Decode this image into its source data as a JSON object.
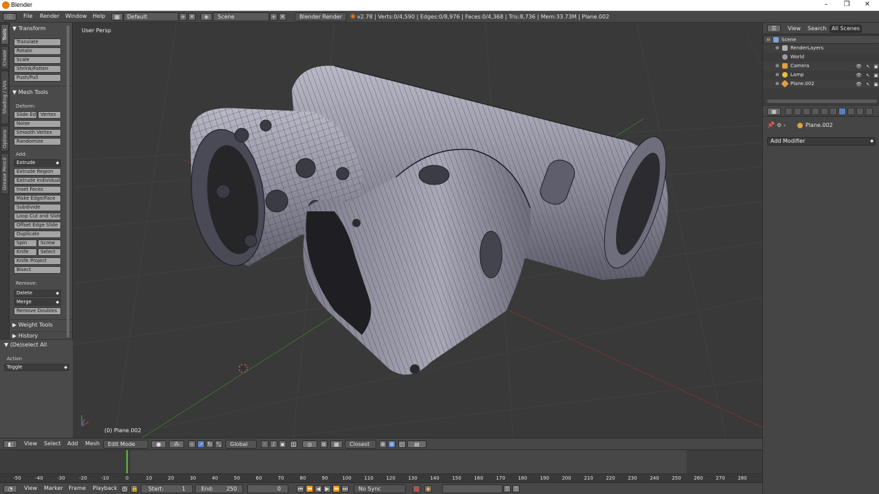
{
  "window": {
    "title": "Blender",
    "controls": [
      "–",
      "❐",
      "✕"
    ]
  },
  "info_header": {
    "menus": [
      "File",
      "Render",
      "Window",
      "Help"
    ],
    "layout": "Default",
    "scene": "Scene",
    "engine": "Blender Render",
    "stats": "v2.78 | Verts:0/4,590 | Edges:0/8,976 | Faces:0/4,368 | Tris:8,736 | Mem:33.73M | Plane.002"
  },
  "tool_tabs": [
    "Tools",
    "Create",
    "Shading / UVs",
    "Options",
    "Grease Pencil"
  ],
  "tool_shelf": {
    "transform": {
      "header": "▼ Transform",
      "buttons": [
        "Translate",
        "Rotate",
        "Scale",
        "Shrink/Fatten",
        "Push/Pull"
      ]
    },
    "mesh_tools": {
      "header": "▼ Mesh Tools",
      "deform_label": "Deform:",
      "slide_edge": "Slide Ed",
      "vertex": "Vertex",
      "noise": "Noise",
      "smooth_vertex": "Smooth Vertex",
      "randomize": "Randomize",
      "add_label": "Add:",
      "extrude": "Extrude",
      "extrude_region": "Extrude Region",
      "extrude_individual": "Extrude Individual",
      "inset_faces": "Inset Faces",
      "make_edge_face": "Make Edge/Face",
      "subdivide": "Subdivide",
      "loop_cut": "Loop Cut and Slide",
      "offset_edge": "Offset Edge Slide",
      "duplicate": "Duplicate",
      "spin": "Spin",
      "screw": "Screw",
      "knife": "Knife",
      "select": "Select",
      "knife_project": "Knife Project",
      "bisect": "Bisect",
      "remove_label": "Remove:",
      "delete": "Delete",
      "merge": "Merge",
      "remove_doubles": "Remove Doubles"
    },
    "weight_tools": "▶ Weight Tools",
    "history": "▶ History",
    "operator": {
      "header": "▼ (De)select All",
      "action_label": "Action",
      "action_value": "Toggle"
    }
  },
  "viewport": {
    "label": "User Persp",
    "object": "(0) Plane.002"
  },
  "viewport_header": {
    "menus": [
      "View",
      "Select",
      "Add",
      "Mesh"
    ],
    "mode": "Edit Mode",
    "orientation": "Global",
    "snap": "Closest"
  },
  "timeline": {
    "current_frame": 0,
    "ticks": [
      -50,
      -40,
      -30,
      -20,
      -10,
      0,
      10,
      20,
      30,
      40,
      50,
      60,
      70,
      80,
      90,
      100,
      110,
      120,
      130,
      140,
      150,
      160,
      170,
      180,
      190,
      200,
      210,
      220,
      230,
      240,
      250,
      260,
      270,
      280
    ],
    "menus": [
      "View",
      "Marker",
      "Frame",
      "Playback"
    ],
    "start_label": "Start:",
    "start_value": "1",
    "end_label": "End:",
    "end_value": "250",
    "frame_value": "0",
    "sync": "No Sync"
  },
  "outliner": {
    "tabs": [
      "View",
      "Search",
      "All Scenes"
    ],
    "items": [
      {
        "name": "Scene",
        "color": "#7aa4d6"
      },
      {
        "name": "RenderLayers",
        "color": "#b0b0b0"
      },
      {
        "name": "World",
        "color": "#9a9a9a"
      },
      {
        "name": "Camera",
        "color": "#e0a040"
      },
      {
        "name": "Lamp",
        "color": "#e0c040"
      },
      {
        "name": "Plane.002",
        "color": "#e0a040"
      }
    ]
  },
  "properties": {
    "object": "Plane.002",
    "add_modifier": "Add Modifier"
  },
  "colors": {
    "accent_blue": "#5680c2",
    "frame_green": "#5fbf3c",
    "viewport_bg": "#393939"
  }
}
